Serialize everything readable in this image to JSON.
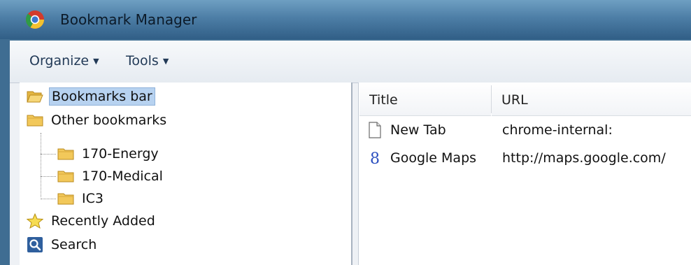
{
  "window": {
    "title": "Bookmark Manager"
  },
  "toolbar": {
    "organize_label": "Organize",
    "tools_label": "Tools"
  },
  "tree": {
    "items": [
      {
        "label": "Bookmarks bar",
        "icon": "folder-open-icon",
        "selected": true
      },
      {
        "label": "Other bookmarks",
        "icon": "folder-icon"
      },
      {
        "label": "170-Energy",
        "icon": "folder-icon"
      },
      {
        "label": "170-Medical",
        "icon": "folder-icon"
      },
      {
        "label": "IC3",
        "icon": "folder-icon"
      },
      {
        "label": "Recently Added",
        "icon": "star-icon"
      },
      {
        "label": "Search",
        "icon": "search-icon"
      }
    ]
  },
  "list": {
    "columns": [
      "Title",
      "URL"
    ],
    "rows": [
      {
        "title": "New Tab",
        "url": "chrome-internal:",
        "icon": "page-icon"
      },
      {
        "title": "Google Maps",
        "url": "http://maps.google.com/",
        "icon": "google-g-icon"
      }
    ]
  },
  "colors": {
    "titlebar": "#4d7ea6",
    "selection": "#b7d2f0",
    "folder": "#f2c85a"
  }
}
